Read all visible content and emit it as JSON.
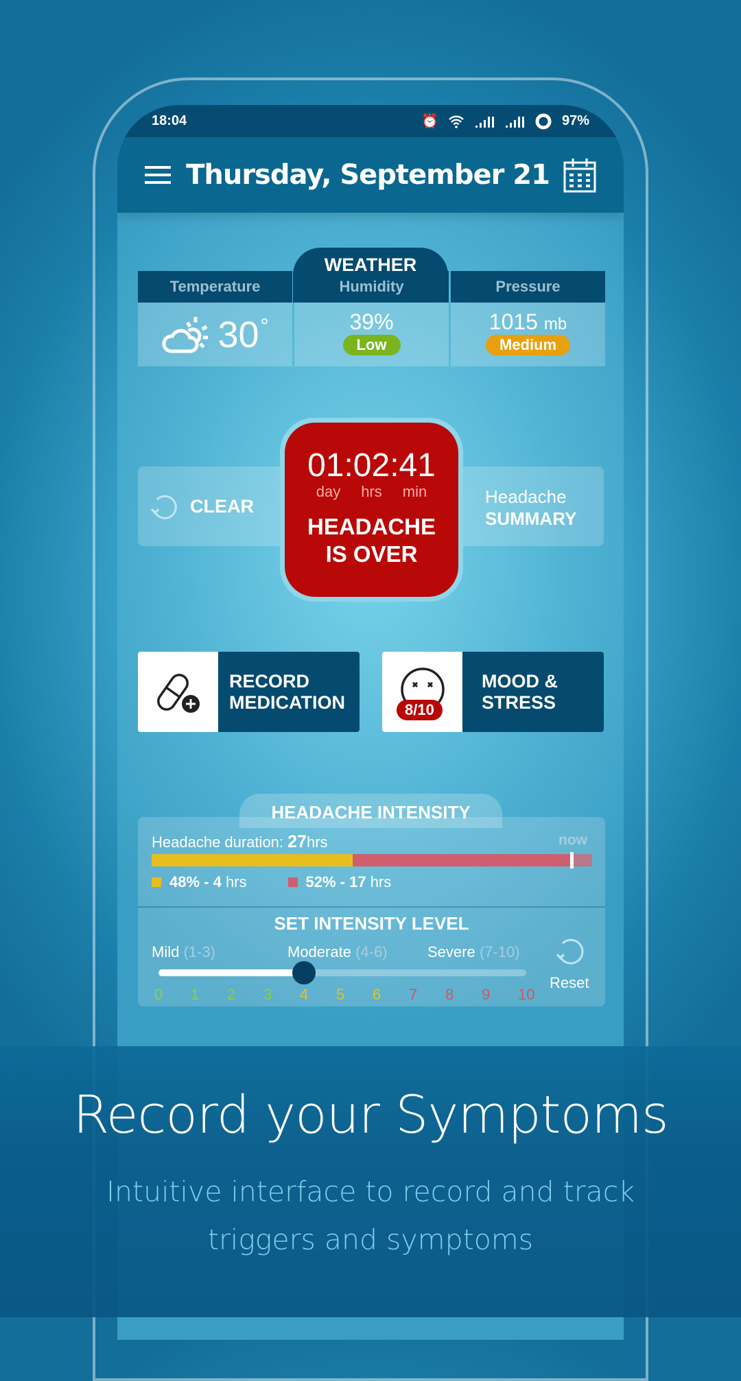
{
  "status": {
    "time": "18:04",
    "battery": "97%"
  },
  "header": {
    "title": "Thursday, September 21"
  },
  "weather": {
    "tab": "WEATHER",
    "temperature_label": "Temperature",
    "temperature": "30",
    "degree": "°",
    "humidity_label": "Humidity",
    "humidity": "39%",
    "humidity_badge": "Low",
    "pressure_label": "Pressure",
    "pressure": "1015",
    "pressure_unit": "mb",
    "pressure_badge": "Medium",
    "colors": {
      "low": "#7ab51d",
      "medium": "#e8a00e"
    }
  },
  "timer": {
    "value": "01:02:41",
    "units": [
      "day",
      "hrs",
      "min"
    ],
    "line1": "HEADACHE",
    "line2": "IS OVER",
    "color": "#b90808"
  },
  "clear_label": "CLEAR",
  "summary": {
    "line1": "Headache",
    "line2": "SUMMARY"
  },
  "medication": {
    "line1": "RECORD",
    "line2": "MEDICATION"
  },
  "mood": {
    "line1": "MOOD &",
    "line2": "STRESS",
    "badge": "8/10"
  },
  "intensity": {
    "tab": "HEADACHE INTENSITY",
    "duration_label": "Headache duration: ",
    "duration_value": "27",
    "duration_unit": "hrs",
    "now": "now",
    "segments": [
      {
        "percent": 48,
        "label_bold": "48% - 4",
        "label_unit": " hrs",
        "color": "#e8be1e"
      },
      {
        "percent": 52,
        "label_bold": "52% - 17",
        "label_unit": " hrs",
        "color": "#cf5f6e"
      }
    ],
    "now_position": 0.95,
    "set_title": "SET INTENSITY LEVEL",
    "ranges": [
      {
        "name": "Mild",
        "range": "(1-3)"
      },
      {
        "name": "Moderate",
        "range": "(4-6)"
      },
      {
        "name": "Severe",
        "range": "(7-10)"
      }
    ],
    "level": 4,
    "scale": [
      "0",
      "1",
      "2",
      "3",
      "4",
      "5",
      "6",
      "7",
      "8",
      "9",
      "10"
    ],
    "scale_colors": [
      "#8fcf3a",
      "#8fcf3a",
      "#8fcf3a",
      "#8fcf3a",
      "#e8c21e",
      "#e8c21e",
      "#e8c21e",
      "#c65a66",
      "#c65a66",
      "#c65a66",
      "#c65a66"
    ],
    "reset": "Reset"
  },
  "promo": {
    "title": "Record your Symptoms",
    "subtitle_line1": "Intuitive interface to record and track",
    "subtitle_line2": "triggers and symptoms"
  }
}
